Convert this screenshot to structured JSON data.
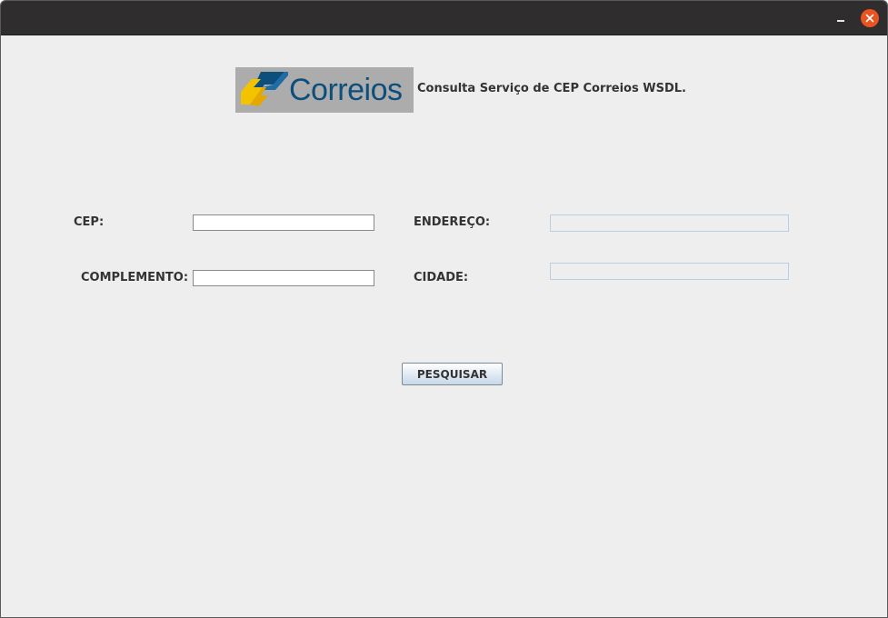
{
  "window": {
    "minimize_icon": "minimize-icon",
    "close_icon": "close-icon",
    "close_color": "#e95420"
  },
  "header": {
    "logo_text": "Correios",
    "title": "Consulta Serviço de CEP Correios WSDL."
  },
  "form": {
    "cep_label": "CEP:",
    "cep_value": "",
    "complemento_label": "COMPLEMENTO:",
    "complemento_value": "",
    "endereco_label": "ENDEREÇO:",
    "endereco_value": "",
    "cidade_label": "CIDADE:",
    "cidade_value": ""
  },
  "actions": {
    "search_label": "PESQUISAR"
  },
  "colors": {
    "brand_blue": "#0d4f7c",
    "brand_yellow": "#f4c300",
    "background": "#eeeeee",
    "titlebar": "#2f2d2d"
  }
}
